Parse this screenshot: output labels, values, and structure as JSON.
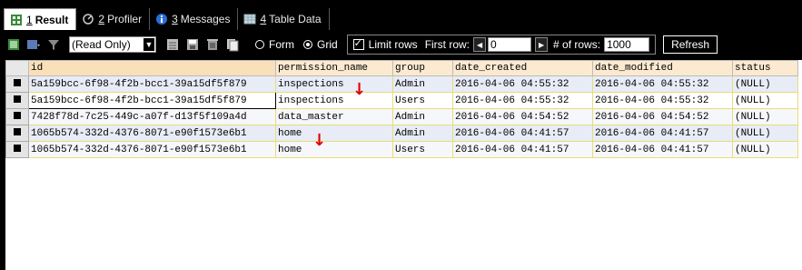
{
  "tabs": [
    {
      "num": "1",
      "label": "Result",
      "icon": "grid-result-icon",
      "active": true
    },
    {
      "num": "2",
      "label": "Profiler",
      "icon": "profiler-icon",
      "active": false
    },
    {
      "num": "3",
      "label": "Messages",
      "icon": "info-icon",
      "active": false
    },
    {
      "num": "4",
      "label": "Table Data",
      "icon": "table-icon",
      "active": false
    }
  ],
  "toolbar": {
    "mode_value": "(Read Only)",
    "form_label": "Form",
    "grid_label": "Grid",
    "view_selected": "Grid",
    "limit_rows_label": "Limit rows",
    "limit_rows_checked": true,
    "first_row_label": "First row:",
    "first_row_value": "0",
    "num_rows_label": "# of rows:",
    "num_rows_value": "1000",
    "refresh_label": "Refresh"
  },
  "grid": {
    "columns": [
      "id",
      "permission_name",
      "group",
      "date_created",
      "date_modified",
      "status"
    ],
    "rows": [
      [
        "5a159bcc-6f98-4f2b-bcc1-39a15df5f879",
        "inspections",
        "Admin",
        "2016-04-06 04:55:32",
        "2016-04-06 04:55:32",
        "(NULL)"
      ],
      [
        "5a159bcc-6f98-4f2b-bcc1-39a15df5f879",
        "inspections",
        "Users",
        "2016-04-06 04:55:32",
        "2016-04-06 04:55:32",
        "(NULL)"
      ],
      [
        "7428f78d-7c25-449c-a07f-d13f5f109a4d",
        "data_master",
        "Admin",
        "2016-04-06 04:54:52",
        "2016-04-06 04:54:52",
        "(NULL)"
      ],
      [
        "1065b574-332d-4376-8071-e90f1573e6b1",
        "home",
        "Admin",
        "2016-04-06 04:41:57",
        "2016-04-06 04:41:57",
        "(NULL)"
      ],
      [
        "1065b574-332d-4376-8071-e90f1573e6b1",
        "home",
        "Users",
        "2016-04-06 04:41:57",
        "2016-04-06 04:41:57",
        "(NULL)"
      ]
    ]
  },
  "annotations": {
    "arrow_glyph": "↓",
    "arrow_color": "#e00000"
  }
}
